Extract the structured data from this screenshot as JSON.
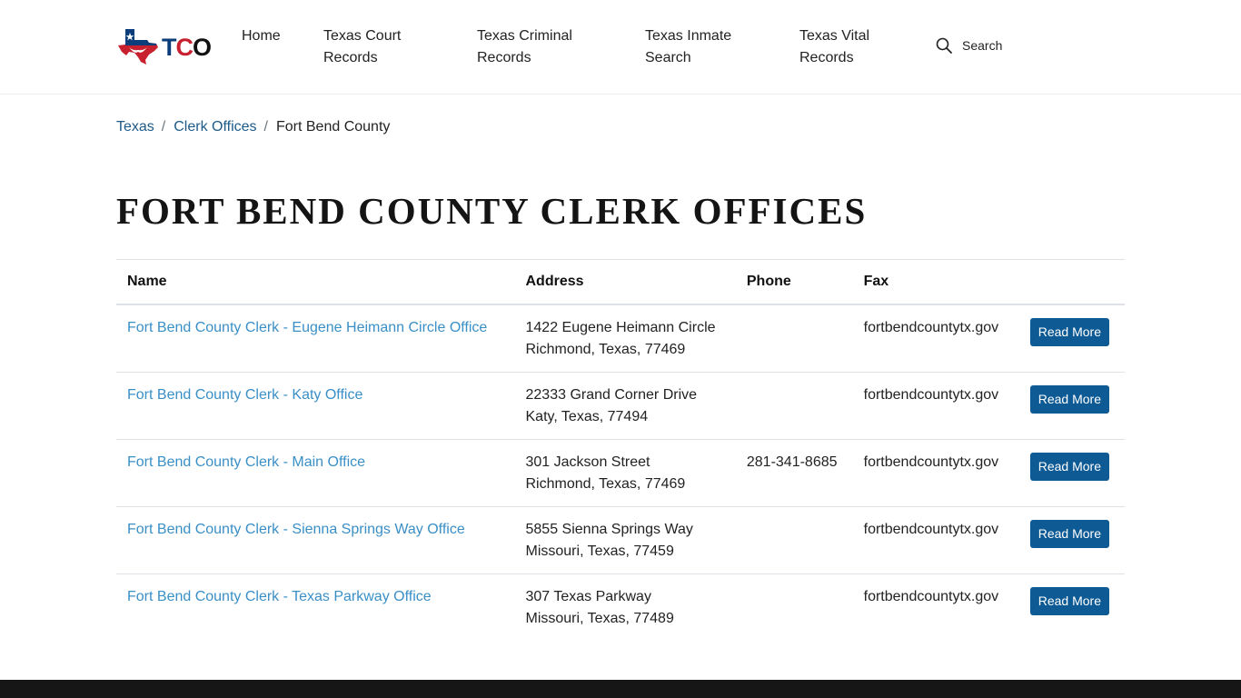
{
  "header": {
    "logo": {
      "text_t": "T",
      "text_c": "C",
      "text_o": "O",
      "icon": "texas-flag-map-icon"
    },
    "nav": [
      {
        "label": "Home"
      },
      {
        "label": "Texas Court Records"
      },
      {
        "label": "Texas Criminal Records"
      },
      {
        "label": "Texas Inmate Search"
      },
      {
        "label": "Texas Vital Records"
      }
    ],
    "search": {
      "label": "Search",
      "icon": "search-icon"
    }
  },
  "breadcrumb": {
    "items": [
      {
        "label": "Texas"
      },
      {
        "label": "Clerk Offices"
      }
    ],
    "separator": "/",
    "current": "Fort Bend County"
  },
  "page_title": "FORT BEND COUNTY CLERK OFFICES",
  "table": {
    "headers": {
      "name": "Name",
      "address": "Address",
      "phone": "Phone",
      "fax": "Fax"
    },
    "button_label": "Read More",
    "rows": [
      {
        "name": "Fort Bend County Clerk - Eugene Heimann Circle Office",
        "address1": "1422 Eugene Heimann Circle",
        "address2": "Richmond, Texas, 77469",
        "phone": "",
        "fax": "fortbendcountytx.gov"
      },
      {
        "name": "Fort Bend County Clerk - Katy Office",
        "address1": "22333 Grand Corner Drive",
        "address2": "Katy, Texas, 77494",
        "phone": "",
        "fax": "fortbendcountytx.gov"
      },
      {
        "name": "Fort Bend County Clerk - Main Office",
        "address1": "301 Jackson Street",
        "address2": "Richmond, Texas, 77469",
        "phone": "281-341-8685",
        "fax": "fortbendcountytx.gov"
      },
      {
        "name": "Fort Bend County Clerk - Sienna Springs Way Office",
        "address1": "5855 Sienna Springs Way",
        "address2": "Missouri, Texas, 77459",
        "phone": "",
        "fax": "fortbendcountytx.gov"
      },
      {
        "name": "Fort Bend County Clerk - Texas Parkway Office",
        "address1": "307 Texas Parkway",
        "address2": "Missouri, Texas, 77489",
        "phone": "",
        "fax": "fortbendcountytx.gov"
      }
    ]
  },
  "colors": {
    "link": "#3a8fc7",
    "breadcrumb_link": "#1d5987",
    "button": "#0d5a95",
    "footer": "#161616"
  }
}
